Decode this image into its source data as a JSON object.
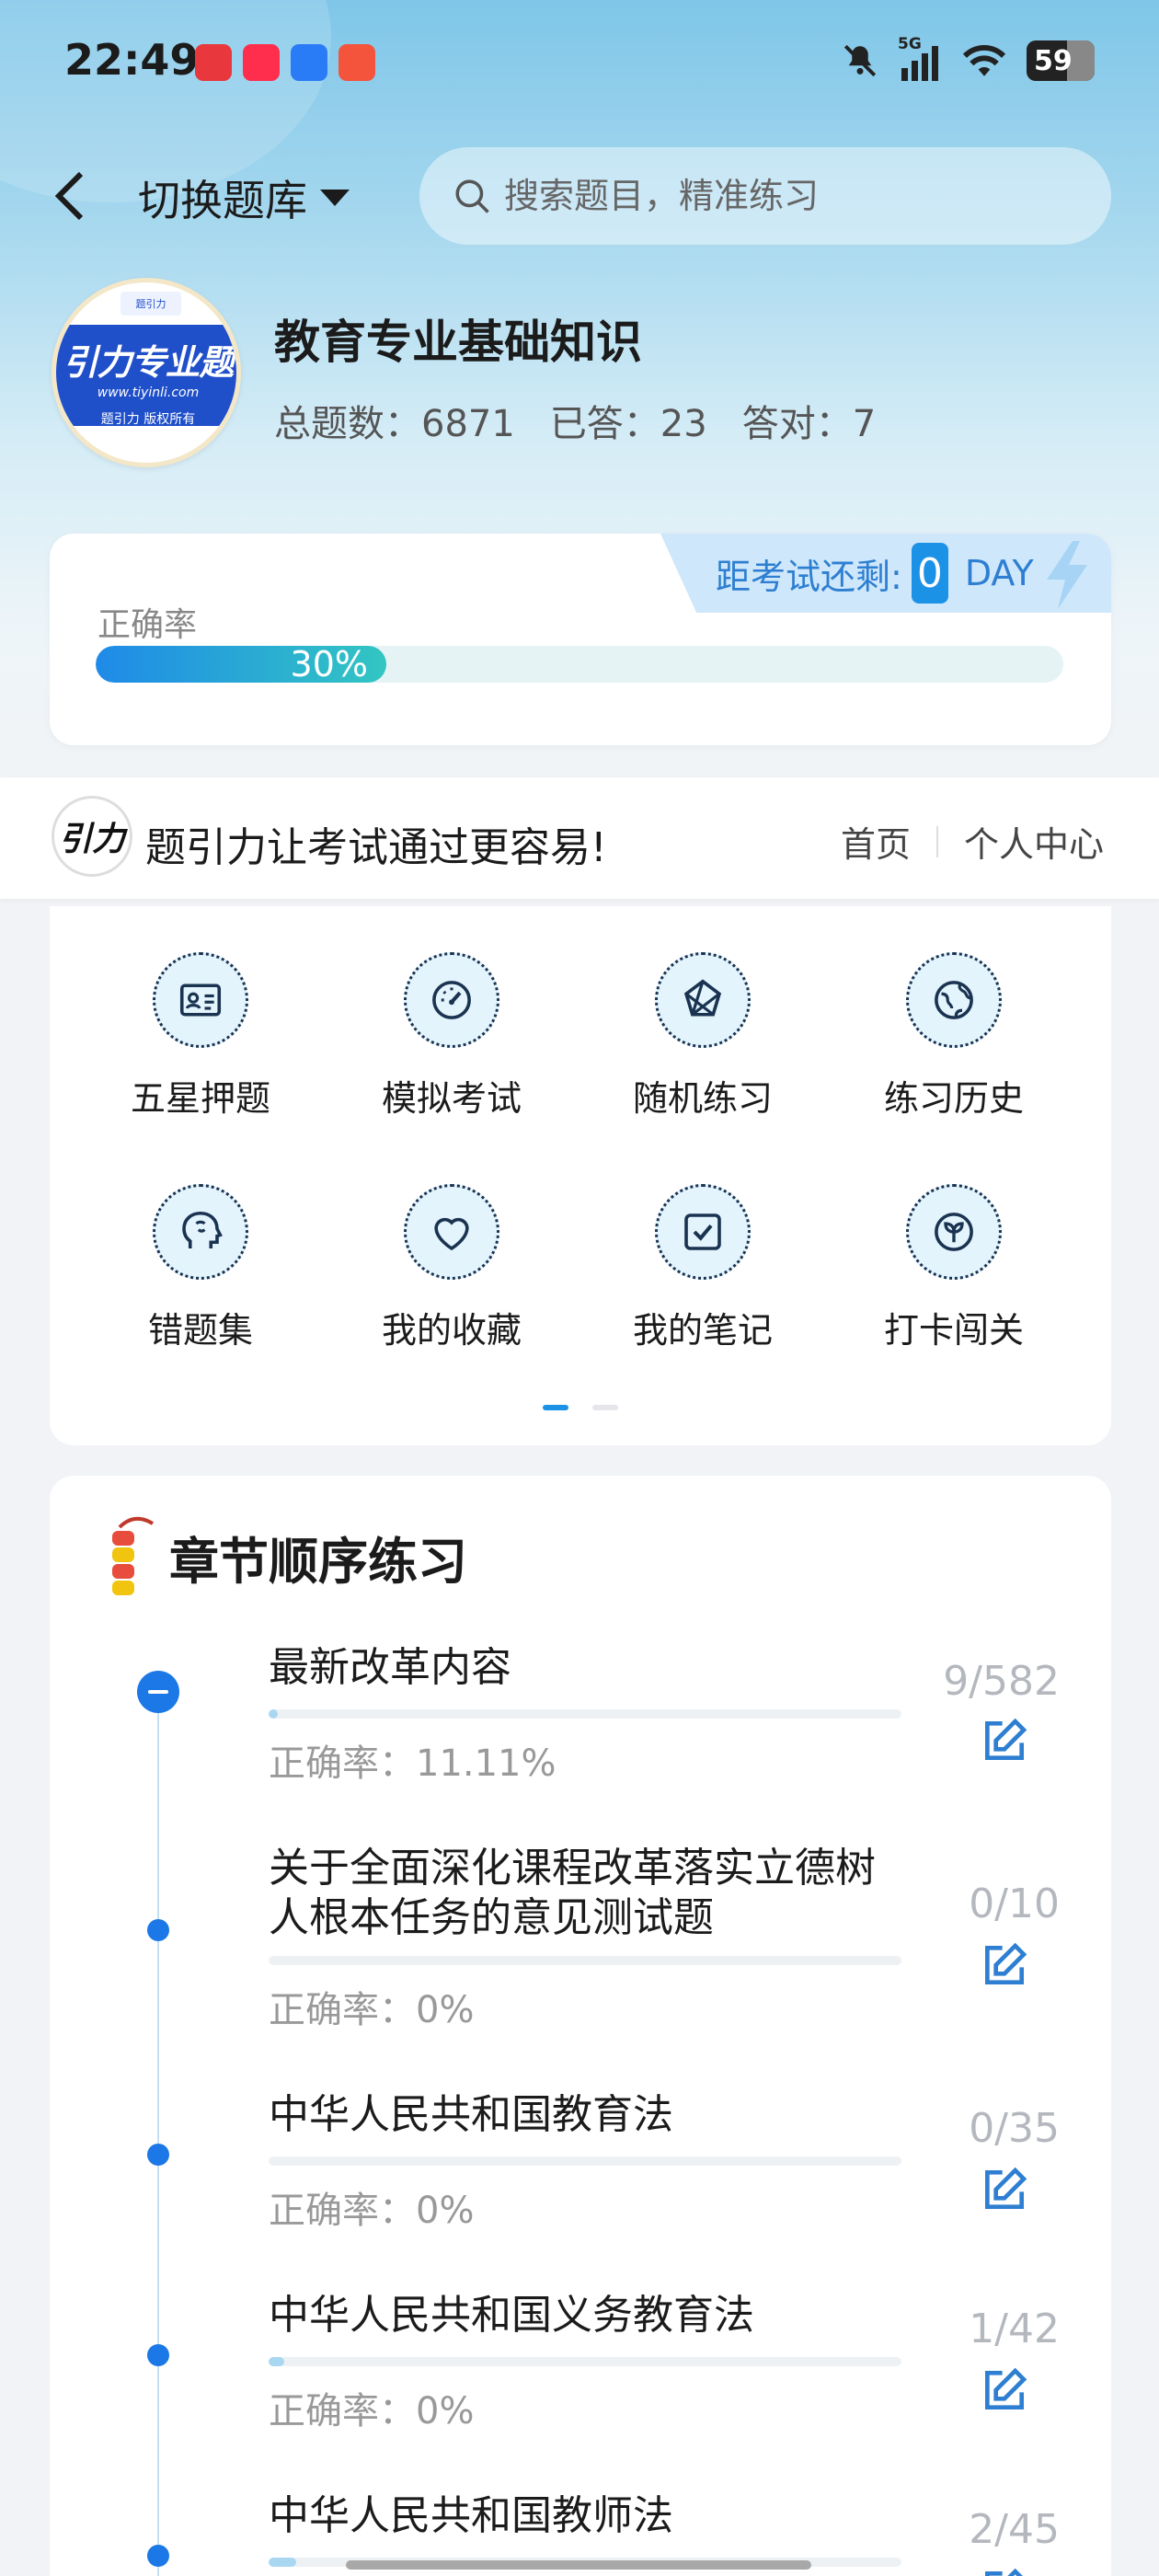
{
  "status_bar": {
    "time": "22:49",
    "network": "5G",
    "battery": "59"
  },
  "nav": {
    "switch_label": "切换题库"
  },
  "search": {
    "placeholder": "搜索题目，精准练习"
  },
  "course": {
    "logo_title": "引力专业题",
    "logo_url": "www.tiyinli.com",
    "logo_copyright": "题引力 版权所有",
    "logo_badge": "题引力",
    "title": "教育专业基础知识",
    "total_label": "总题数：6871",
    "answered_label": "已答：23",
    "correct_label": "答对：7"
  },
  "exam_countdown": {
    "label": "距考试还剩:",
    "days": "0",
    "unit": "DAY"
  },
  "accuracy": {
    "label": "正确率",
    "value_text": "30%",
    "value": 0.3
  },
  "slogan": {
    "logo_text": "引力",
    "text": "题引力让考试通过更容易!",
    "links": [
      "首页",
      "个人中心"
    ]
  },
  "features": [
    {
      "label": "五星押题",
      "icon": "id-card-icon"
    },
    {
      "label": "模拟考试",
      "icon": "speedometer-icon"
    },
    {
      "label": "随机练习",
      "icon": "random-shape-icon"
    },
    {
      "label": "练习历史",
      "icon": "globe-icon"
    },
    {
      "label": "错题集",
      "icon": "head-icon"
    },
    {
      "label": "我的收藏",
      "icon": "heart-icon"
    },
    {
      "label": "我的笔记",
      "icon": "checkbox-note-icon"
    },
    {
      "label": "打卡闯关",
      "icon": "leaf-icon"
    }
  ],
  "pager": {
    "pages": 2,
    "active": 0
  },
  "chapters": {
    "title": "章节顺序练习",
    "items": [
      {
        "name": "最新改革内容",
        "accuracy": "正确率：11.11%",
        "count": "9/582",
        "progress": 0.015
      },
      {
        "name": "关于全面深化课程改革落实立德树人根本任务的意见测试题",
        "accuracy": "正确率：0%",
        "count": "0/10",
        "progress": 0
      },
      {
        "name": "中华人民共和国教育法",
        "accuracy": "正确率：0%",
        "count": "0/35",
        "progress": 0
      },
      {
        "name": "中华人民共和国义务教育法",
        "accuracy": "正确率：0%",
        "count": "1/42",
        "progress": 0.024
      },
      {
        "name": "中华人民共和国教师法",
        "accuracy": "",
        "count": "2/45",
        "progress": 0.044
      }
    ]
  },
  "colors": {
    "accent": "#1c92e6",
    "timeline_node": "#1c78e6",
    "progress_start": "#1f8ae8",
    "progress_end": "#32c6c2"
  }
}
